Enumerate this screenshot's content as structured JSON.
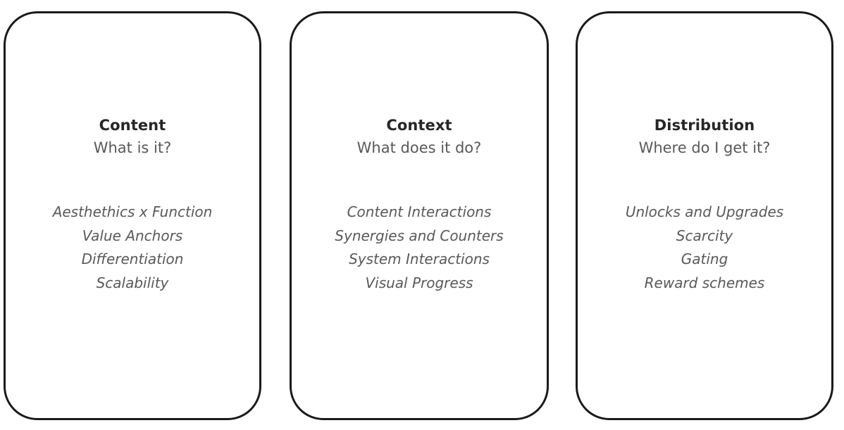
{
  "diagram": {
    "background_color": "#ffffff",
    "card_border_color": "#1a1a1a",
    "title_color": "#262626",
    "text_color": "#595959",
    "cards": [
      {
        "title": "Content",
        "question": "What is it?",
        "items": [
          "Aesthethics x Function",
          "Value Anchors",
          "Differentiation",
          "Scalability"
        ]
      },
      {
        "title": "Context",
        "question": "What does it do?",
        "items": [
          "Content Interactions",
          "Synergies and Counters",
          "System Interactions",
          "Visual Progress"
        ]
      },
      {
        "title": "Distribution",
        "question": "Where do I get it?",
        "items": [
          "Unlocks and Upgrades",
          "Scarcity",
          "Gating",
          "Reward schemes"
        ]
      }
    ]
  }
}
